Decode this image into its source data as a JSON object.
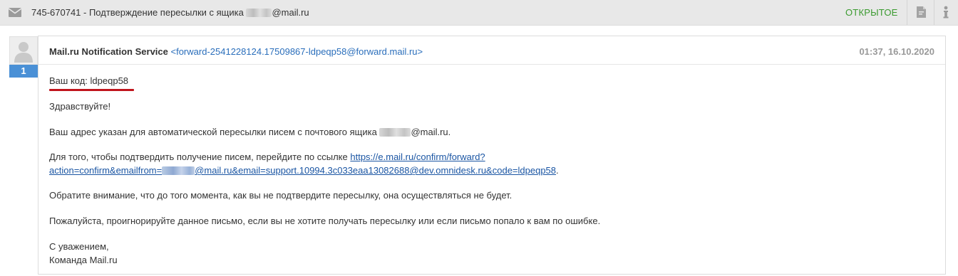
{
  "topbar": {
    "subject_prefix": "745-670741 - Подтверждение пересылки с ящика",
    "subject_suffix": "@mail.ru",
    "status": "ОТКРЫТОЕ",
    "icons": [
      "envelope-icon",
      "document-icon",
      "info-icon"
    ]
  },
  "message": {
    "counter": "1",
    "sender_name": "Mail.ru Notification Service",
    "sender_address": "<forward-2541228124.17509867-ldpeqp58@forward.mail.ru>",
    "date": "01:37, 16.10.2020",
    "code_line": "Ваш код: ldpeqp58",
    "greeting": "Здравствуйте!",
    "p1_prefix": "Ваш адрес указан для автоматической пересылки писем с почтового ящика",
    "p1_suffix": "@mail.ru.",
    "p2_prefix": "Для того, чтобы подтвердить получение писем, перейдите по ссылке",
    "link_part1": "https://e.mail.ru/confirm/forward?",
    "link_part2_prefix": "action=confirm&emailfrom=",
    "link_part2_suffix": "@mail.ru&email=support.10994.3c033eaa13082688@dev.omnidesk.ru&code=ldpeqp58",
    "link_trailing": ".",
    "p3": "Обратите внимание, что до того момента, как вы не подтвердите пересылку, она осуществляться не будет.",
    "p4": "Пожалуйста, проигнорируйте данное письмо, если вы не хотите получать пересылку или если письмо попало к вам по ошибке.",
    "signature_line1": "С уважением,",
    "signature_line2": "Команда Mail.ru"
  },
  "colors": {
    "status_green": "#3a9a2f",
    "link_blue": "#1a55a3",
    "counter_blue": "#4a90d6",
    "highlight_red": "#c0141c"
  }
}
